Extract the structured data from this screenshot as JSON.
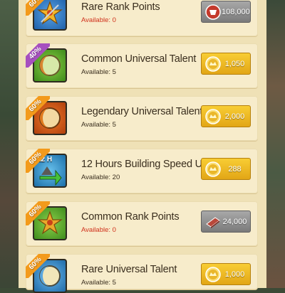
{
  "offers": [
    {
      "title": "Rare Rank Points",
      "available": "Available: 0",
      "discount": "60%",
      "price": "108,000",
      "currency": "rank-point-icon",
      "icon": "rare-rank-points-icon",
      "avail_state": "red",
      "btn": "grey",
      "ribbon": "orange"
    },
    {
      "title": "Common Universal Talent",
      "available": "Available: 5",
      "discount": "40%",
      "price": "1,050",
      "currency": "coin-icon",
      "icon": "common-universal-talent-icon",
      "avail_state": "dark",
      "btn": "gold",
      "ribbon": "purple"
    },
    {
      "title": "Legendary Universal Talent",
      "available": "Available: 5",
      "discount": "60%",
      "price": "2,000",
      "currency": "coin-icon",
      "icon": "legendary-universal-talent-icon",
      "avail_state": "dark",
      "btn": "gold",
      "ribbon": "orange"
    },
    {
      "title": "12 Hours Building Speed Up",
      "available": "Available: 20",
      "discount": "60%",
      "price": "288",
      "currency": "coin-icon",
      "icon": "building-speed-up-icon",
      "icon_text": "12 H",
      "avail_state": "dark",
      "btn": "gold",
      "ribbon": "orange"
    },
    {
      "title": "Common Rank Points",
      "available": "Available: 0",
      "discount": "60%",
      "price": "24,000",
      "currency": "rank-book-icon",
      "icon": "common-rank-points-icon",
      "avail_state": "red",
      "btn": "grey",
      "ribbon": "orange"
    },
    {
      "title": "Rare Universal Talent",
      "available": "Available: 5",
      "discount": "60%",
      "price": "1,000",
      "currency": "coin-icon",
      "icon": "rare-universal-talent-icon",
      "avail_state": "dark",
      "btn": "gold",
      "ribbon": "orange"
    }
  ],
  "colors": {
    "panel": "#efe1b6",
    "card": "#f7eccb",
    "gold_button": "#f0b824",
    "grey_button": "#8f8f8f",
    "ribbon_orange": "#f39a1b",
    "ribbon_purple": "#a64fbf",
    "unavailable_text": "#d0301b"
  }
}
